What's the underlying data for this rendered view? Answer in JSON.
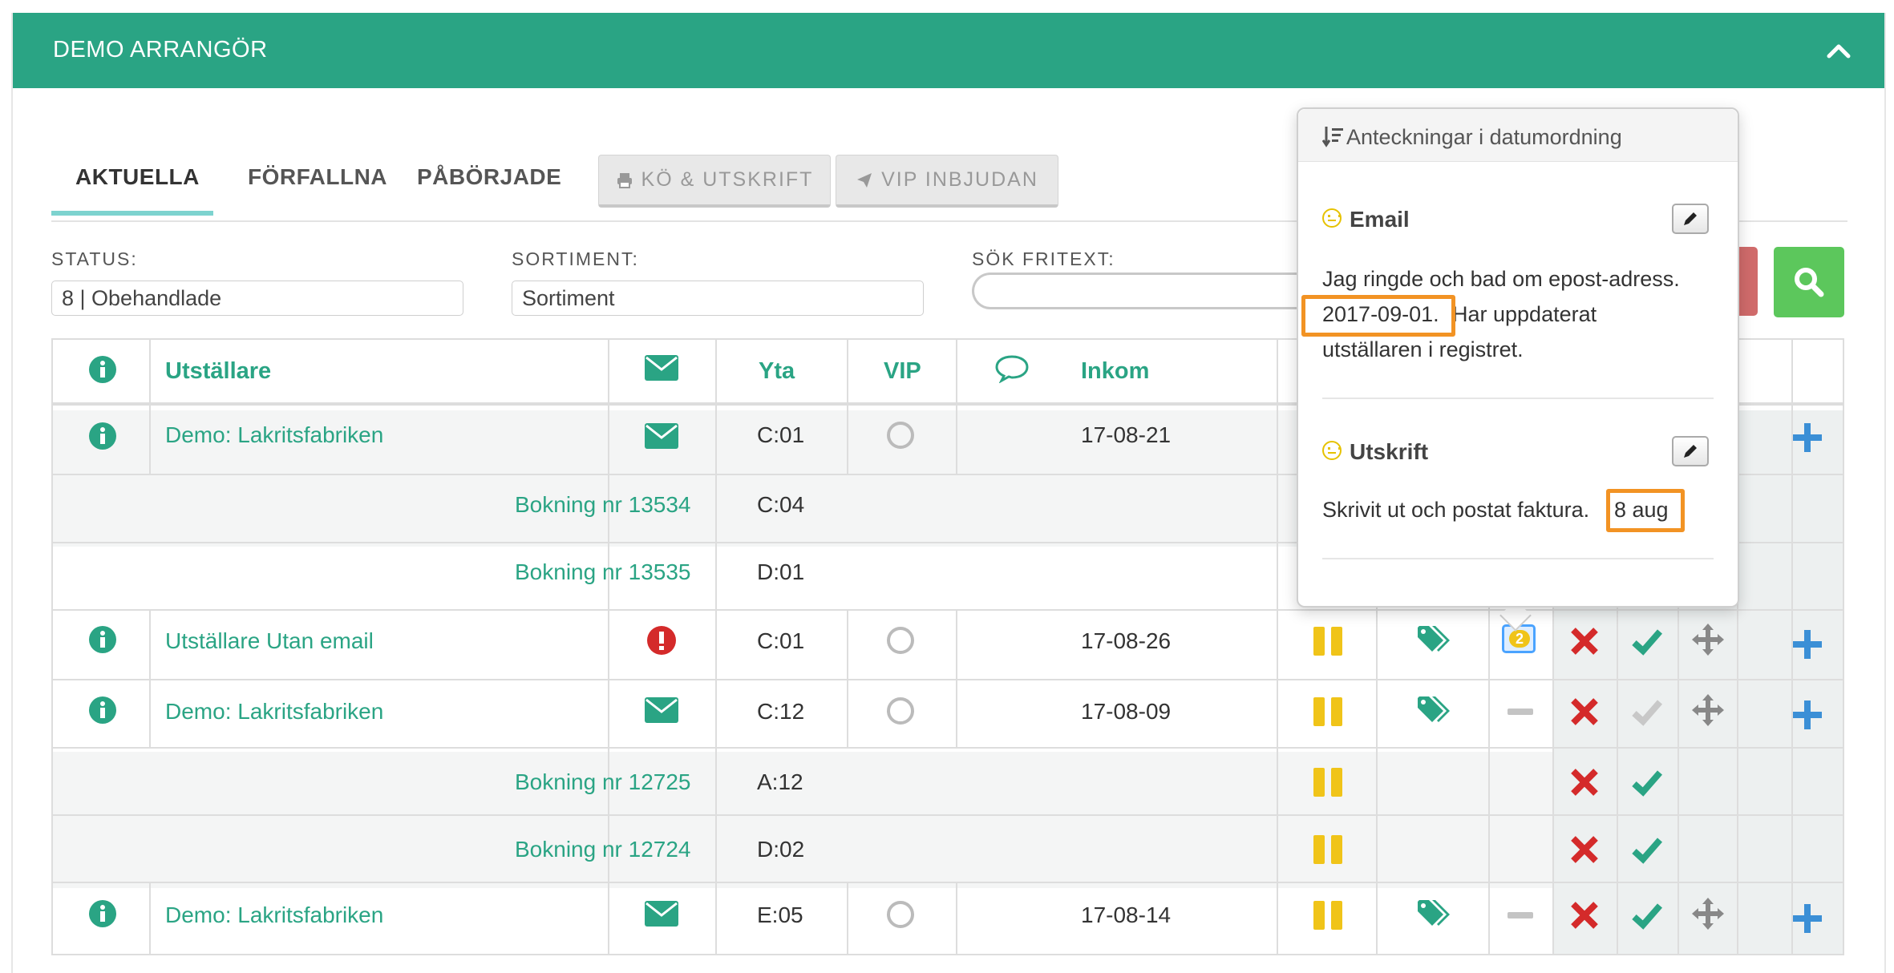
{
  "panel": {
    "title": "DEMO ARRANGÖR"
  },
  "tabs": [
    {
      "label": "AKTUELLA",
      "active": true
    },
    {
      "label": "FÖRFALLNA"
    },
    {
      "label": "PÅBÖRJADE"
    }
  ],
  "buttons": {
    "queue_print": "KÖ & UTSKRIFT",
    "vip_invite": "VIP INBJUDAN"
  },
  "filters": {
    "status_label": "STATUS:",
    "status_value": "8 | Obehandlade",
    "assortment_label": "SORTIMENT:",
    "assortment_value": "Sortiment",
    "search_label": "SÖK FRITEXT:"
  },
  "table": {
    "headers": {
      "exhibitor": "Utställare",
      "area": "Yta",
      "vip": "VIP",
      "received": "Inkom"
    },
    "rows": [
      {
        "exhibitor": "Demo: Lakritsfabriken",
        "area": "C:01",
        "received": "17-08-21"
      },
      {
        "booking": "Bokning nr 13534",
        "area": "C:04"
      },
      {
        "booking": "Bokning nr 13535",
        "area": "D:01"
      },
      {
        "exhibitor": "Utställare Utan email",
        "area": "C:01",
        "received": "17-08-26",
        "note_count": "2"
      },
      {
        "exhibitor": "Demo: Lakritsfabriken",
        "area": "C:12",
        "received": "17-08-09"
      },
      {
        "booking": "Bokning nr 12725",
        "area": "A:12"
      },
      {
        "booking": "Bokning nr 12724",
        "area": "D:02"
      },
      {
        "exhibitor": "Demo: Lakritsfabriken",
        "area": "E:05",
        "received": "17-08-14"
      }
    ]
  },
  "popover": {
    "title": "Anteckningar i datumordning",
    "notes": [
      {
        "title": "Email",
        "line1": "Jag ringde och bad om epost-adress.",
        "date": "2017-09-01.",
        "line2": " Har uppdaterat",
        "line3": "utställaren i registret."
      },
      {
        "title": "Utskrift",
        "line1": "Skrivit ut och postat faktura.",
        "date": "8 aug"
      }
    ]
  },
  "colors": {
    "primary": "#2aa484",
    "danger": "#d42a2a",
    "warning": "#f0c419",
    "add": "#3b8fd6",
    "highlight": "#f29324"
  }
}
